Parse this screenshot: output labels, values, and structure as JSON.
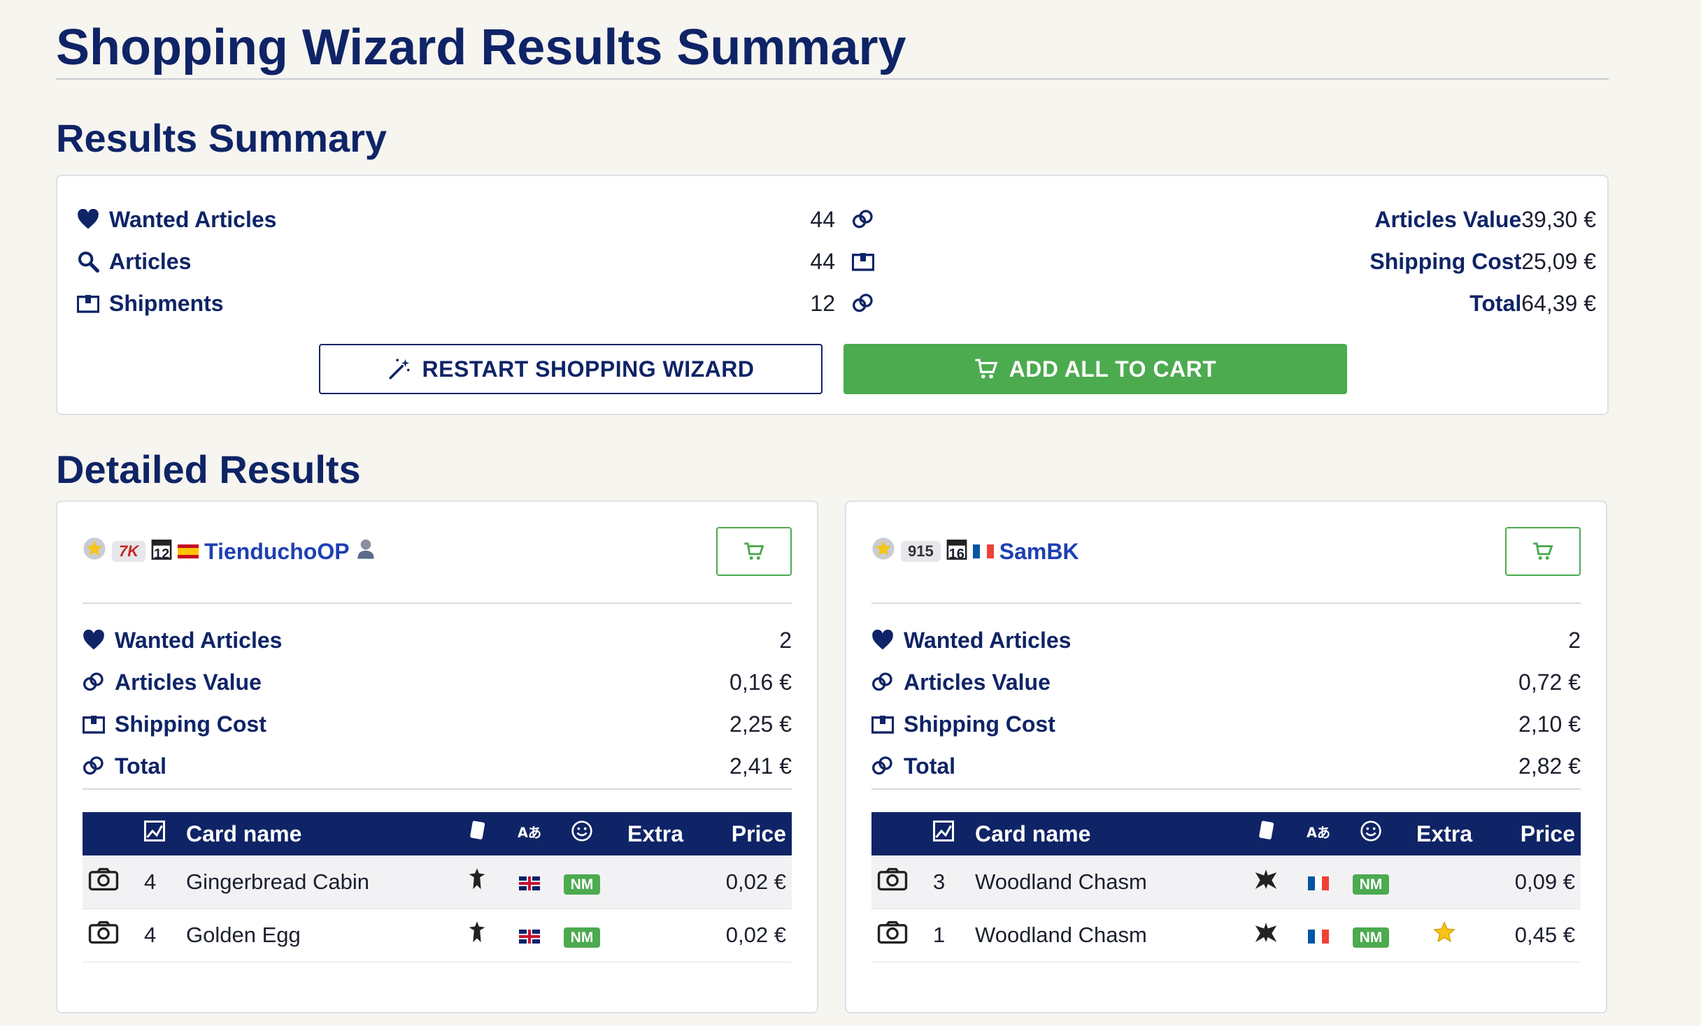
{
  "page_title": "Shopping Wizard Results Summary",
  "results_summary": {
    "title": "Results Summary",
    "left": [
      {
        "icon": "heart-icon",
        "label": "Wanted Articles",
        "value": "44"
      },
      {
        "icon": "search-icon",
        "label": "Articles",
        "value": "44"
      },
      {
        "icon": "shipment-icon",
        "label": "Shipments",
        "value": "12"
      }
    ],
    "right": [
      {
        "icon": "coins-icon",
        "label": "Articles Value",
        "value": "39,30 €"
      },
      {
        "icon": "shipment-icon",
        "label": "Shipping Cost",
        "value": "25,09 €"
      },
      {
        "icon": "coins-icon",
        "label": "Total",
        "value": "64,39 €"
      }
    ],
    "restart_button": "RESTART SHOPPING WIZARD",
    "add_all_button": "ADD ALL TO CART"
  },
  "detailed_results": {
    "title": "Detailed Results",
    "sellers": [
      {
        "reputation_badge": "7K",
        "days_badge": "12",
        "flag": "es",
        "name": "TienduchoOP",
        "stats": [
          {
            "icon": "heart-icon",
            "label": "Wanted Articles",
            "value": "2"
          },
          {
            "icon": "coins-icon",
            "label": "Articles Value",
            "value": "0,16 €"
          },
          {
            "icon": "shipment-icon",
            "label": "Shipping Cost",
            "value": "2,25 €"
          },
          {
            "icon": "coins-icon",
            "label": "Total",
            "value": "2,41 €"
          }
        ],
        "table_headers": {
          "name": "Card name",
          "extra": "Extra",
          "price": "Price"
        },
        "rows": [
          {
            "qty": "4",
            "name": "Gingerbread Cabin",
            "lang": "uk",
            "condition": "NM",
            "extra": "",
            "price": "0,02 €"
          },
          {
            "qty": "4",
            "name": "Golden Egg",
            "lang": "uk",
            "condition": "NM",
            "extra": "",
            "price": "0,02 €"
          }
        ]
      },
      {
        "reputation_badge": "915",
        "days_badge": "16",
        "flag": "fr",
        "name": "SamBK",
        "stats": [
          {
            "icon": "heart-icon",
            "label": "Wanted Articles",
            "value": "2"
          },
          {
            "icon": "coins-icon",
            "label": "Articles Value",
            "value": "0,72 €"
          },
          {
            "icon": "shipment-icon",
            "label": "Shipping Cost",
            "value": "2,10 €"
          },
          {
            "icon": "coins-icon",
            "label": "Total",
            "value": "2,82 €"
          }
        ],
        "table_headers": {
          "name": "Card name",
          "extra": "Extra",
          "price": "Price"
        },
        "rows": [
          {
            "qty": "3",
            "name": "Woodland Chasm",
            "lang": "fr",
            "condition": "NM",
            "extra": "",
            "price": "0,09 €"
          },
          {
            "qty": "1",
            "name": "Woodland Chasm",
            "lang": "fr",
            "condition": "NM",
            "extra": "foil-star",
            "price": "0,45 €"
          }
        ]
      }
    ]
  },
  "colors": {
    "brand": "#0f2466",
    "accent_green": "#4caa4f",
    "link": "#1e3fb3"
  }
}
